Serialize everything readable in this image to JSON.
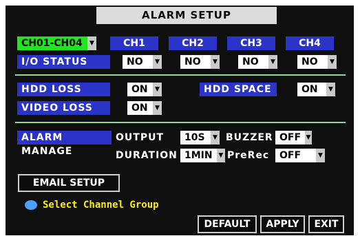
{
  "window": {
    "title": "ALARM SETUP"
  },
  "channel_group": {
    "selected": "CH01-CH04"
  },
  "channels": [
    "CH1",
    "CH2",
    "CH3",
    "CH4"
  ],
  "io_status": {
    "label": "I/O STATUS",
    "values": [
      "NO",
      "NO",
      "NO",
      "NO"
    ]
  },
  "hdd_loss": {
    "label": "HDD LOSS",
    "value": "ON"
  },
  "hdd_space": {
    "label": "HDD SPACE",
    "value": "ON"
  },
  "video_loss": {
    "label": "VIDEO LOSS",
    "value": "ON"
  },
  "alarm_manage": {
    "label": "ALARM MANAGE",
    "output": {
      "label": "OUTPUT",
      "value": "10S"
    },
    "buzzer": {
      "label": "BUZZER",
      "value": "OFF"
    },
    "duration": {
      "label": "DURATION",
      "value": "1MIN"
    },
    "prerec": {
      "label": "PreRec",
      "value": "OFF"
    }
  },
  "email_setup": {
    "label": "EMAIL SETUP"
  },
  "hint": {
    "text": "Select Channel Group"
  },
  "buttons": {
    "default": "DEFAULT",
    "apply": "APPLY",
    "exit": "EXIT"
  },
  "colors": {
    "panel": "#0f0f0f",
    "label_blue": "#2a34c9",
    "selected_green": "#1fe61f",
    "hint_yellow": "#ffef00",
    "divider": "#8fd99a"
  }
}
